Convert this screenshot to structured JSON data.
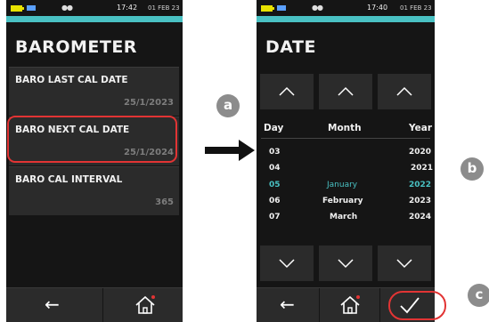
{
  "left_screen": {
    "status": {
      "time": "17:42",
      "date": "01 FEB 23"
    },
    "title": "BAROMETER",
    "rows": [
      {
        "label": "BARO LAST CAL DATE",
        "value": "25/1/2023"
      },
      {
        "label": "BARO NEXT CAL DATE",
        "value": "25/1/2024"
      },
      {
        "label": "BARO CAL INTERVAL",
        "value": "365"
      }
    ]
  },
  "right_screen": {
    "status": {
      "time": "17:40",
      "date": "01 FEB 23"
    },
    "title": "DATE",
    "columns": {
      "day": "Day",
      "month": "Month",
      "year": "Year"
    },
    "days": [
      "03",
      "04",
      "05",
      "06",
      "07"
    ],
    "months": [
      "",
      "",
      "January",
      "February",
      "March"
    ],
    "years": [
      "2020",
      "2021",
      "2022",
      "2023",
      "2024"
    ],
    "selected_index": 2
  },
  "callouts": {
    "a": "a",
    "b": "b",
    "c": "c"
  },
  "colors": {
    "accent": "#49c1c3",
    "highlight": "#e23434",
    "background": "#151515",
    "panel": "#2b2b2b"
  }
}
